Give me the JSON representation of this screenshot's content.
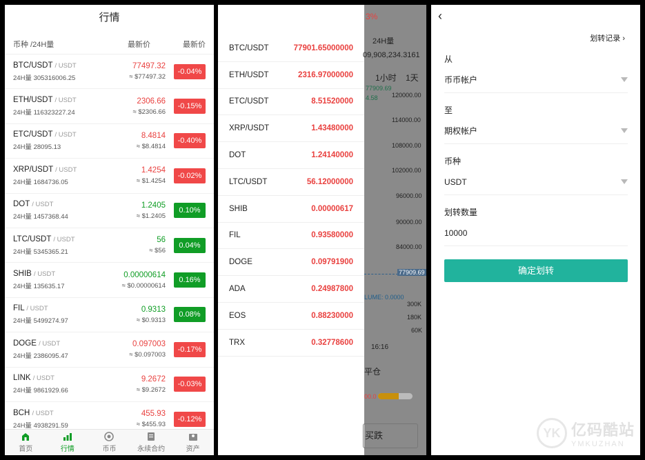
{
  "markets": {
    "title": "行情",
    "header": {
      "col1": "币种 /24H量",
      "col2": "最新价",
      "col3": "最新价"
    },
    "rows": [
      {
        "symbol": "BTC/USDT",
        "quote": "/ USDT",
        "vol": "24H量 305316006.25",
        "price": "77497.32",
        "approx": "≈ $77497.32",
        "change": "-0.04%",
        "dir": "down"
      },
      {
        "symbol": "ETH/USDT",
        "quote": "/ USDT",
        "vol": "24H量 116323227.24",
        "price": "2306.66",
        "approx": "≈ $2306.66",
        "change": "-0.15%",
        "dir": "down"
      },
      {
        "symbol": "ETC/USDT",
        "quote": "/ USDT",
        "vol": "24H量 28095.13",
        "price": "8.4814",
        "approx": "≈ $8.4814",
        "change": "-0.40%",
        "dir": "down"
      },
      {
        "symbol": "XRP/USDT",
        "quote": "/ USDT",
        "vol": "24H量 1684736.05",
        "price": "1.4254",
        "approx": "≈ $1.4254",
        "change": "-0.02%",
        "dir": "down"
      },
      {
        "symbol": "DOT",
        "quote": "/ USDT",
        "vol": "24H量 1457368.44",
        "price": "1.2405",
        "approx": "≈ $1.2405",
        "change": "0.10%",
        "dir": "up"
      },
      {
        "symbol": "LTC/USDT",
        "quote": "/ USDT",
        "vol": "24H量 5345365.21",
        "price": "56",
        "approx": "≈ $56",
        "change": "0.04%",
        "dir": "up"
      },
      {
        "symbol": "SHIB",
        "quote": "/ USDT",
        "vol": "24H量 135635.17",
        "price": "0.00000614",
        "approx": "≈ $0.00000614",
        "change": "0.16%",
        "dir": "up"
      },
      {
        "symbol": "FIL",
        "quote": "/ USDT",
        "vol": "24H量 5499274.97",
        "price": "0.9313",
        "approx": "≈ $0.9313",
        "change": "0.08%",
        "dir": "up"
      },
      {
        "symbol": "DOGE",
        "quote": "/ USDT",
        "vol": "24H量 2386095.47",
        "price": "0.097003",
        "approx": "≈ $0.097003",
        "change": "-0.17%",
        "dir": "down"
      },
      {
        "symbol": "LINK",
        "quote": "/ USDT",
        "vol": "24H量 9861929.66",
        "price": "9.2672",
        "approx": "≈ $9.2672",
        "change": "-0.03%",
        "dir": "down"
      },
      {
        "symbol": "BCH",
        "quote": "/ USDT",
        "vol": "24H量 4938291.59",
        "price": "455.93",
        "approx": "≈ $455.93",
        "change": "-0.12%",
        "dir": "down"
      }
    ],
    "tabbar": [
      {
        "label": "首页",
        "icon": "home-icon"
      },
      {
        "label": "行情",
        "icon": "chart-icon"
      },
      {
        "label": "币币",
        "icon": "coin-icon"
      },
      {
        "label": "永续合约",
        "icon": "contract-icon"
      },
      {
        "label": "资产",
        "icon": "wallet-icon"
      }
    ]
  },
  "drawer": {
    "rows": [
      {
        "symbol": "BTC/USDT",
        "value": "77901.65000000"
      },
      {
        "symbol": "ETH/USDT",
        "value": "2316.97000000"
      },
      {
        "symbol": "ETC/USDT",
        "value": "8.51520000"
      },
      {
        "symbol": "XRP/USDT",
        "value": "1.43480000"
      },
      {
        "symbol": "DOT",
        "value": "1.24140000"
      },
      {
        "symbol": "LTC/USDT",
        "value": "56.12000000"
      },
      {
        "symbol": "SHIB",
        "value": "0.00000617"
      },
      {
        "symbol": "FIL",
        "value": "0.93580000"
      },
      {
        "symbol": "DOGE",
        "value": "0.09791900"
      },
      {
        "symbol": "ADA",
        "value": "0.24987800"
      },
      {
        "symbol": "EOS",
        "value": "0.88230000"
      },
      {
        "symbol": "TRX",
        "value": "0.32778600"
      }
    ],
    "background": {
      "pct": "3%",
      "vol_label": "24H量",
      "vol_value": "09,908,234.3161",
      "tf1": "1小时",
      "tf2": "1天",
      "ma": "77909.69",
      "ma2": "4.58",
      "y1": "120000.00",
      "y2": "114000.00",
      "y3": "108000.00",
      "y4": "102000.00",
      "y5": "96000.00",
      "y6": "90000.00",
      "y7": "84000.00",
      "cur": "77909.69",
      "volume": "LUME: 0.0000",
      "v1": "300K",
      "v2": "180K",
      "v3": "60K",
      "time": "16:16",
      "close": "平仓",
      "progress_value": "00.0",
      "buy": "买跌"
    }
  },
  "transfer": {
    "back": "‹",
    "record_link": "划转记录 ›",
    "from_label": "从",
    "from_value": "币币帐户",
    "to_label": "至",
    "to_value": "期权帐户",
    "coin_label": "币种",
    "coin_value": "USDT",
    "amount_label": "划转数量",
    "amount_value": "10000",
    "submit": "确定划转",
    "watermark_main": "亿码酷站",
    "watermark_sub": "YMKUZHAN",
    "watermark_logo": "YK"
  },
  "colors": {
    "up": "#109d26",
    "down": "#f04848",
    "accent": "#21b39d"
  }
}
